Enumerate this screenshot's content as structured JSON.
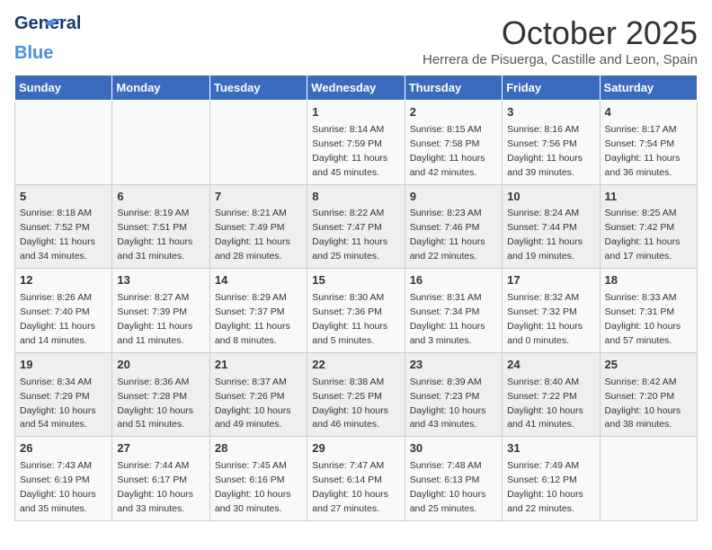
{
  "logo": {
    "line1": "General",
    "line2": "Blue"
  },
  "title": "October 2025",
  "location": "Herrera de Pisuerga, Castille and Leon, Spain",
  "headers": [
    "Sunday",
    "Monday",
    "Tuesday",
    "Wednesday",
    "Thursday",
    "Friday",
    "Saturday"
  ],
  "weeks": [
    [
      {
        "day": "",
        "info": ""
      },
      {
        "day": "",
        "info": ""
      },
      {
        "day": "",
        "info": ""
      },
      {
        "day": "1",
        "info": "Sunrise: 8:14 AM\nSunset: 7:59 PM\nDaylight: 11 hours and 45 minutes."
      },
      {
        "day": "2",
        "info": "Sunrise: 8:15 AM\nSunset: 7:58 PM\nDaylight: 11 hours and 42 minutes."
      },
      {
        "day": "3",
        "info": "Sunrise: 8:16 AM\nSunset: 7:56 PM\nDaylight: 11 hours and 39 minutes."
      },
      {
        "day": "4",
        "info": "Sunrise: 8:17 AM\nSunset: 7:54 PM\nDaylight: 11 hours and 36 minutes."
      }
    ],
    [
      {
        "day": "5",
        "info": "Sunrise: 8:18 AM\nSunset: 7:52 PM\nDaylight: 11 hours and 34 minutes."
      },
      {
        "day": "6",
        "info": "Sunrise: 8:19 AM\nSunset: 7:51 PM\nDaylight: 11 hours and 31 minutes."
      },
      {
        "day": "7",
        "info": "Sunrise: 8:21 AM\nSunset: 7:49 PM\nDaylight: 11 hours and 28 minutes."
      },
      {
        "day": "8",
        "info": "Sunrise: 8:22 AM\nSunset: 7:47 PM\nDaylight: 11 hours and 25 minutes."
      },
      {
        "day": "9",
        "info": "Sunrise: 8:23 AM\nSunset: 7:46 PM\nDaylight: 11 hours and 22 minutes."
      },
      {
        "day": "10",
        "info": "Sunrise: 8:24 AM\nSunset: 7:44 PM\nDaylight: 11 hours and 19 minutes."
      },
      {
        "day": "11",
        "info": "Sunrise: 8:25 AM\nSunset: 7:42 PM\nDaylight: 11 hours and 17 minutes."
      }
    ],
    [
      {
        "day": "12",
        "info": "Sunrise: 8:26 AM\nSunset: 7:40 PM\nDaylight: 11 hours and 14 minutes."
      },
      {
        "day": "13",
        "info": "Sunrise: 8:27 AM\nSunset: 7:39 PM\nDaylight: 11 hours and 11 minutes."
      },
      {
        "day": "14",
        "info": "Sunrise: 8:29 AM\nSunset: 7:37 PM\nDaylight: 11 hours and 8 minutes."
      },
      {
        "day": "15",
        "info": "Sunrise: 8:30 AM\nSunset: 7:36 PM\nDaylight: 11 hours and 5 minutes."
      },
      {
        "day": "16",
        "info": "Sunrise: 8:31 AM\nSunset: 7:34 PM\nDaylight: 11 hours and 3 minutes."
      },
      {
        "day": "17",
        "info": "Sunrise: 8:32 AM\nSunset: 7:32 PM\nDaylight: 11 hours and 0 minutes."
      },
      {
        "day": "18",
        "info": "Sunrise: 8:33 AM\nSunset: 7:31 PM\nDaylight: 10 hours and 57 minutes."
      }
    ],
    [
      {
        "day": "19",
        "info": "Sunrise: 8:34 AM\nSunset: 7:29 PM\nDaylight: 10 hours and 54 minutes."
      },
      {
        "day": "20",
        "info": "Sunrise: 8:36 AM\nSunset: 7:28 PM\nDaylight: 10 hours and 51 minutes."
      },
      {
        "day": "21",
        "info": "Sunrise: 8:37 AM\nSunset: 7:26 PM\nDaylight: 10 hours and 49 minutes."
      },
      {
        "day": "22",
        "info": "Sunrise: 8:38 AM\nSunset: 7:25 PM\nDaylight: 10 hours and 46 minutes."
      },
      {
        "day": "23",
        "info": "Sunrise: 8:39 AM\nSunset: 7:23 PM\nDaylight: 10 hours and 43 minutes."
      },
      {
        "day": "24",
        "info": "Sunrise: 8:40 AM\nSunset: 7:22 PM\nDaylight: 10 hours and 41 minutes."
      },
      {
        "day": "25",
        "info": "Sunrise: 8:42 AM\nSunset: 7:20 PM\nDaylight: 10 hours and 38 minutes."
      }
    ],
    [
      {
        "day": "26",
        "info": "Sunrise: 7:43 AM\nSunset: 6:19 PM\nDaylight: 10 hours and 35 minutes."
      },
      {
        "day": "27",
        "info": "Sunrise: 7:44 AM\nSunset: 6:17 PM\nDaylight: 10 hours and 33 minutes."
      },
      {
        "day": "28",
        "info": "Sunrise: 7:45 AM\nSunset: 6:16 PM\nDaylight: 10 hours and 30 minutes."
      },
      {
        "day": "29",
        "info": "Sunrise: 7:47 AM\nSunset: 6:14 PM\nDaylight: 10 hours and 27 minutes."
      },
      {
        "day": "30",
        "info": "Sunrise: 7:48 AM\nSunset: 6:13 PM\nDaylight: 10 hours and 25 minutes."
      },
      {
        "day": "31",
        "info": "Sunrise: 7:49 AM\nSunset: 6:12 PM\nDaylight: 10 hours and 22 minutes."
      },
      {
        "day": "",
        "info": ""
      }
    ]
  ]
}
